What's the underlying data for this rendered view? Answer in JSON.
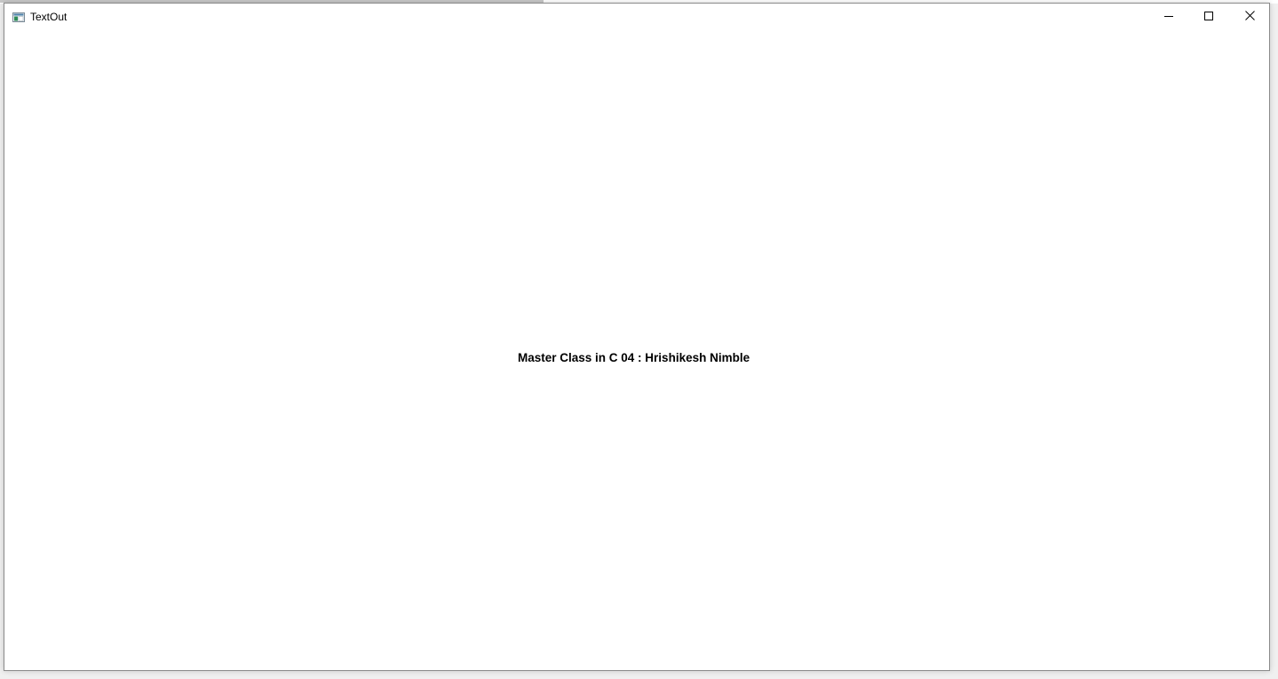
{
  "window": {
    "title": "TextOut",
    "app_icon": "window-app-icon",
    "controls": {
      "minimize_icon": "minimize-icon",
      "maximize_icon": "maximize-icon",
      "close_icon": "close-icon"
    }
  },
  "client": {
    "text": "Master Class in C 04 : Hrishikesh Nimble"
  },
  "colors": {
    "client_background": "#ffffff",
    "text": "#000000",
    "frame_border": "#8a8a8a"
  }
}
